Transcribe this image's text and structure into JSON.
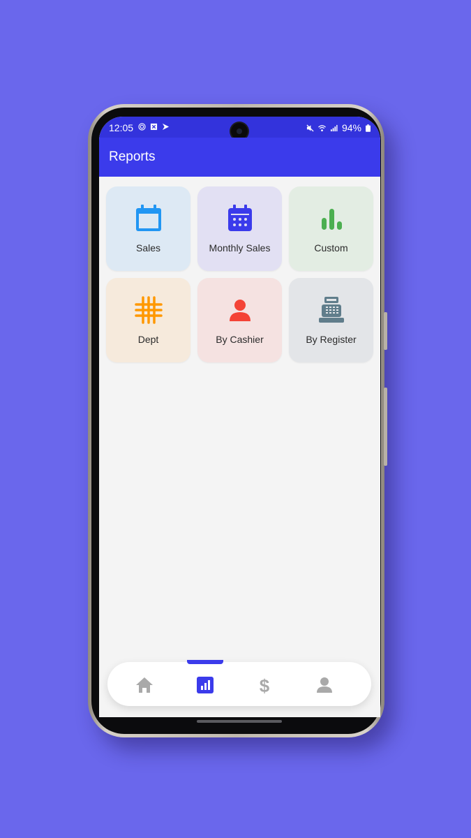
{
  "status": {
    "time": "12:05",
    "battery": "94%",
    "left_icons": [
      "fingerprint-icon",
      "notification-x-icon",
      "notification-app-icon"
    ],
    "right_icons": [
      "mute-icon",
      "wifi-icon",
      "signal-icon",
      "battery-icon"
    ]
  },
  "appbar": {
    "title": "Reports"
  },
  "tiles": [
    {
      "label": "Sales",
      "icon": "calendar-icon",
      "color": "#2196F3",
      "bg": "#DDE9F4"
    },
    {
      "label": "Monthly Sales",
      "icon": "calendar-grid-icon",
      "color": "#3B3BEB",
      "bg": "#E2E0F3"
    },
    {
      "label": "Custom",
      "icon": "bar-chart-icon",
      "color": "#4CAF50",
      "bg": "#E3EDE3"
    },
    {
      "label": "Dept",
      "icon": "grid-hash-icon",
      "color": "#FF9800",
      "bg": "#F6EADC"
    },
    {
      "label": "By Cashier",
      "icon": "person-icon",
      "color": "#F44336",
      "bg": "#F5E2E1"
    },
    {
      "label": "By Register",
      "icon": "cash-register-icon",
      "color": "#607D8B",
      "bg": "#E3E5E8"
    }
  ],
  "bottom_nav": {
    "items": [
      "home-icon",
      "reports-icon",
      "dollar-icon",
      "profile-icon"
    ],
    "active": "reports-icon",
    "active_color": "#3B3BEB",
    "inactive_color": "#A9A9A9"
  }
}
